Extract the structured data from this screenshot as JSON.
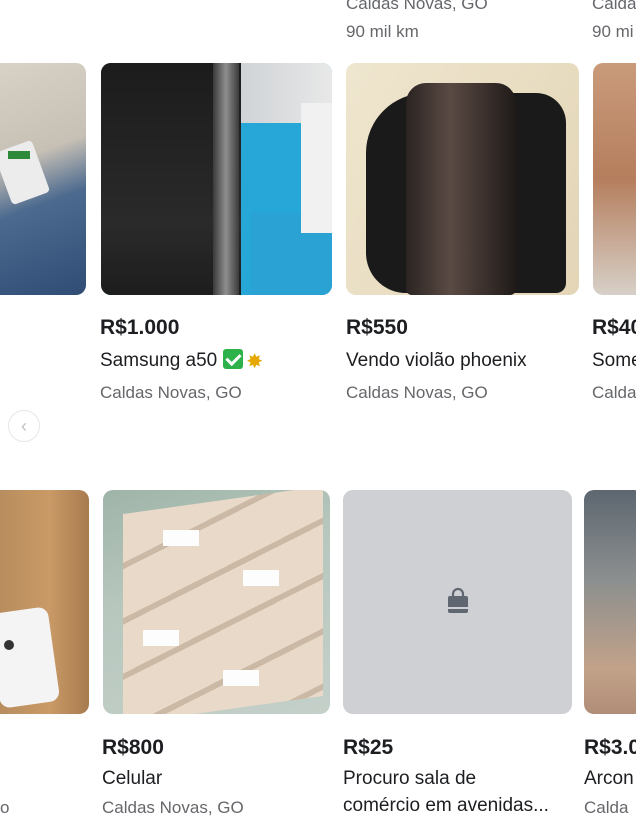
{
  "top_row": {
    "items": [
      {
        "location": "Caldas Novas, GO",
        "detail": "90 mil km"
      },
      {
        "location": "Calda",
        "detail": "90 mi"
      }
    ]
  },
  "row1": [
    {
      "price": "R$1.000",
      "title": "Samsung a50",
      "location": "Caldas Novas, GO"
    },
    {
      "price": "R$550",
      "title": "Vendo violão phoenix",
      "location": "Caldas Novas, GO"
    },
    {
      "price": "R$40",
      "title": "Some",
      "location": "Calda"
    }
  ],
  "row2": [
    {
      "price": "R$800",
      "title": "Celular",
      "location": "Caldas Novas, GO"
    },
    {
      "price": "R$25",
      "title_line1": "Procuro sala de",
      "title_line2": "comércio em avenidas...",
      "location": ""
    },
    {
      "price": "R$3.0",
      "title": "Arcon",
      "location": "Calda"
    }
  ],
  "left_partial": {
    "row2_text": "o"
  },
  "icons": {
    "prev": "chevron-left-icon",
    "placeholder": "shopping-bag-icon"
  }
}
